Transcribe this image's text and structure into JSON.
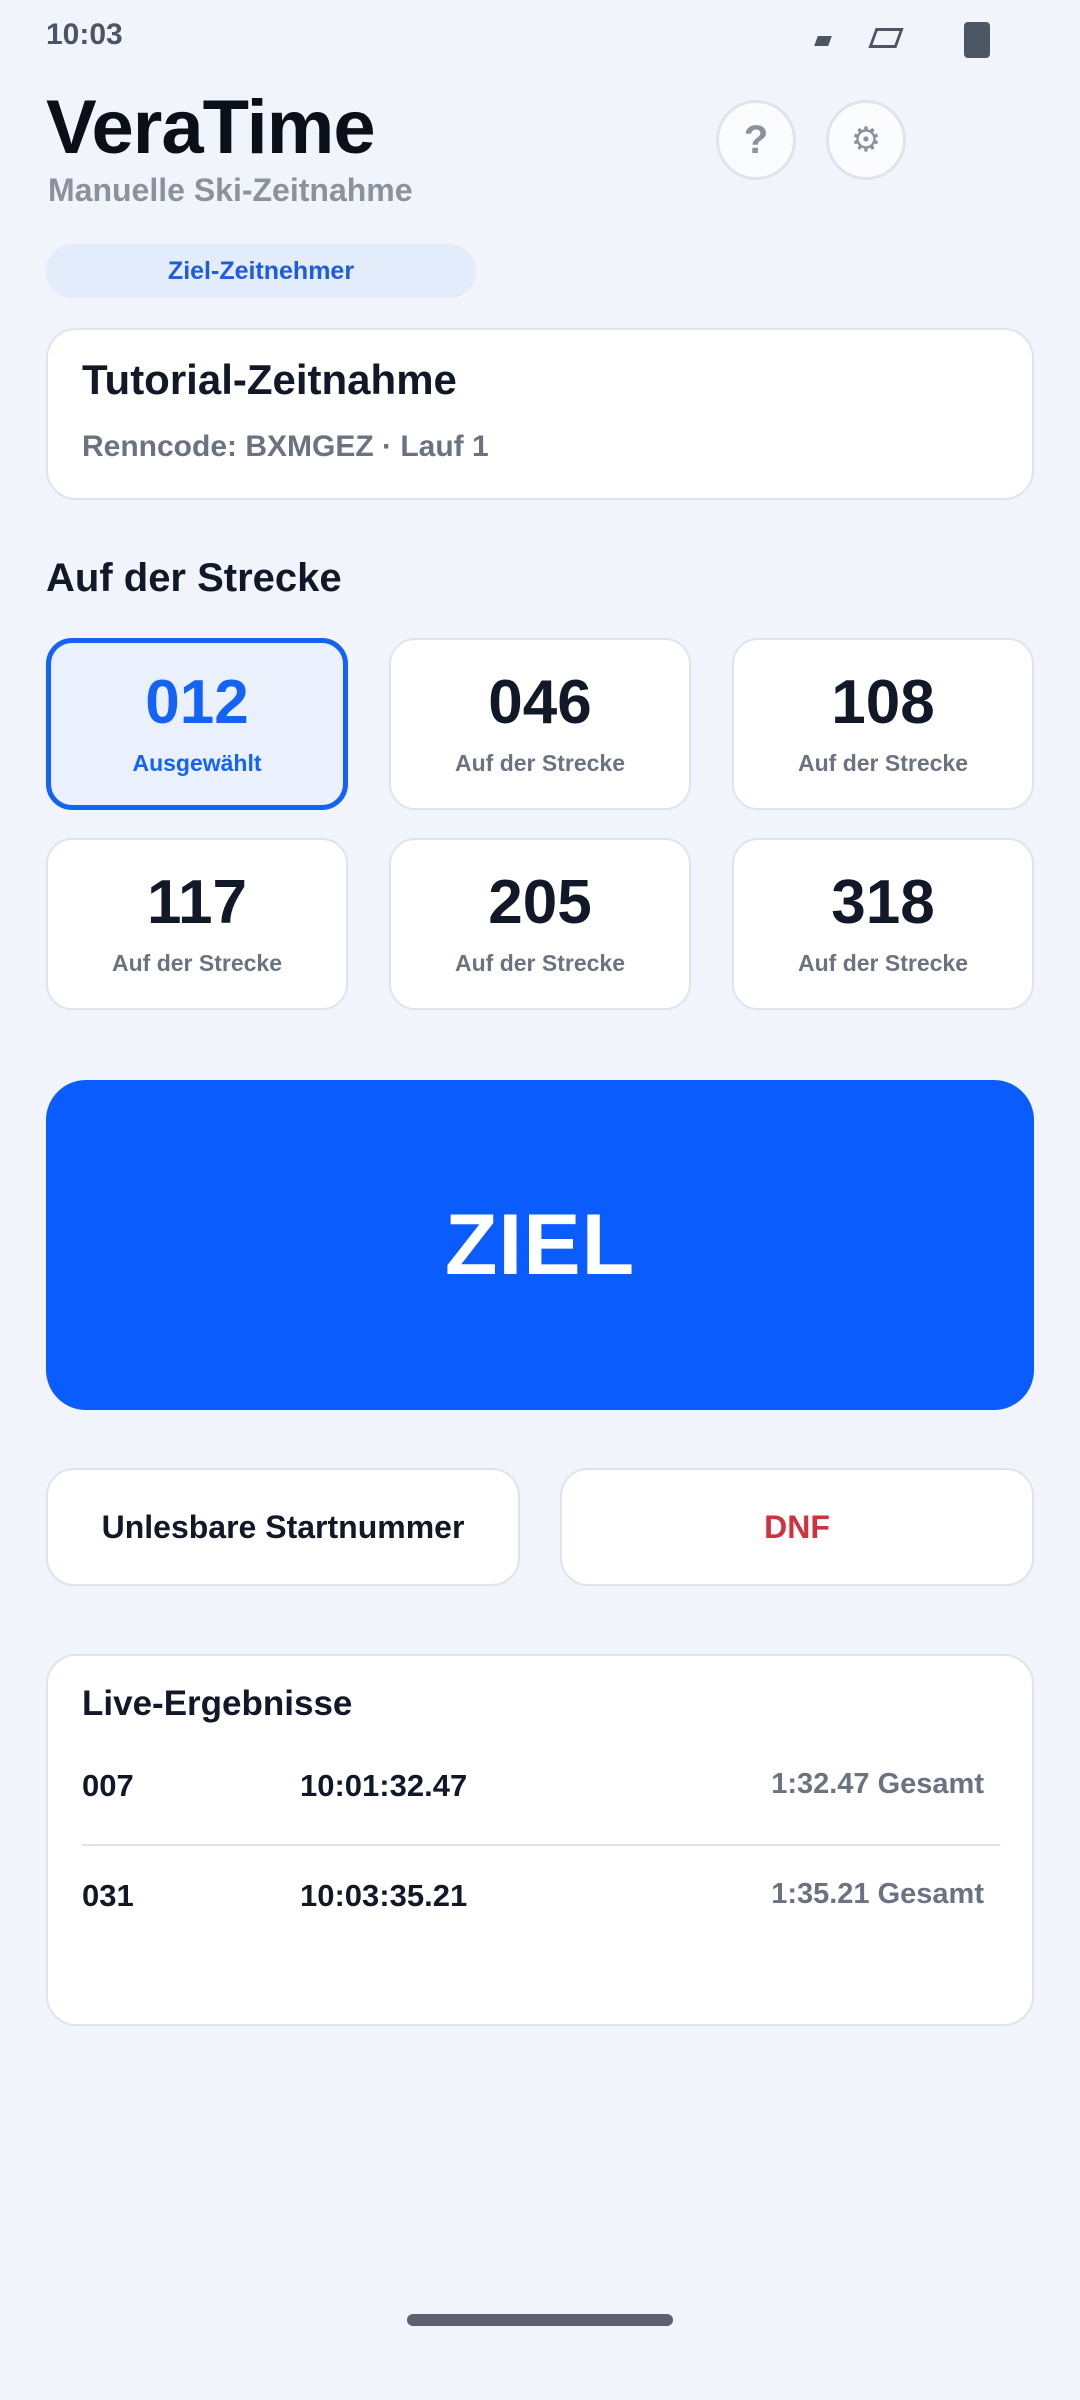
{
  "status_bar": {
    "time": "10:03",
    "icons": [
      "signal-icon",
      "wifi-icon",
      "battery-icon"
    ]
  },
  "header": {
    "title": "VeraTime",
    "subtitle": "Manuelle Ski-Zeitnahme",
    "help_glyph": "?",
    "settings_glyph": "⚙"
  },
  "role_label": "Ziel-Zeitnehmer",
  "race": {
    "title": "Tutorial-Zeitnahme",
    "meta": "Renncode: BXMGEZ · Lauf 1"
  },
  "on_course": {
    "title": "Auf der Strecke",
    "bibs": [
      {
        "number": "012",
        "status": "Ausgewählt",
        "selected": true
      },
      {
        "number": "046",
        "status": "Auf der Strecke",
        "selected": false
      },
      {
        "number": "108",
        "status": "Auf der Strecke",
        "selected": false
      },
      {
        "number": "117",
        "status": "Auf der Strecke",
        "selected": false
      },
      {
        "number": "205",
        "status": "Auf der Strecke",
        "selected": false
      },
      {
        "number": "318",
        "status": "Auf der Strecke",
        "selected": false
      }
    ]
  },
  "finish_button": {
    "label": "ZIEL"
  },
  "actions": {
    "unreadable_label": "Unlesbare Startnummer",
    "dnf_label": "DNF"
  },
  "results": {
    "title": "Live-Ergebnisse",
    "rows": [
      {
        "bib": "007",
        "time": "10:01:32.47",
        "total": "1:32.47 Gesamt"
      },
      {
        "bib": "031",
        "time": "10:03:35.21",
        "total": "1:35.21 Gesamt"
      }
    ]
  },
  "colors": {
    "accent": "#0a5cfd",
    "danger": "#d0323e",
    "background": "#f1f5fb"
  }
}
